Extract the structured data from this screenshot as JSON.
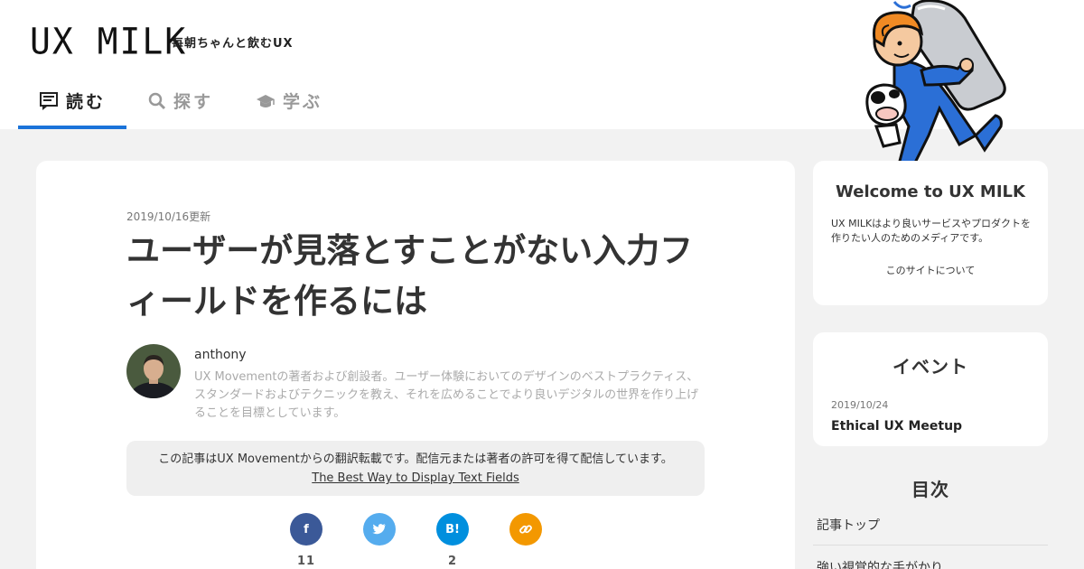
{
  "header": {
    "logo": "UX MILK",
    "tagline": "毎朝ちゃんと飲むUX",
    "nav": [
      {
        "label": "読む",
        "icon": "reader-icon",
        "active": true
      },
      {
        "label": "探す",
        "icon": "search-icon",
        "active": false
      },
      {
        "label": "学ぶ",
        "icon": "graduation-cap-icon",
        "active": false
      }
    ]
  },
  "article": {
    "date": "2019/10/16更新",
    "title": "ユーザーが見落とすことがない入力フィールドを作るには",
    "author": {
      "name": "anthony",
      "bio": "UX Movementの著者および創設者。ユーザー体験においてのデザインのベストプラクティス、スタンダードおよびテクニックを教え、それを広めることでより良いデジタルの世界を作り上げることを目標としています。"
    },
    "notice": {
      "text": "この記事はUX Movementからの翻訳転載です。配信元または著者の許可を得て配信しています。",
      "link": "The Best Way to Display Text Fields"
    },
    "share": [
      {
        "icon": "facebook-icon",
        "glyph": "f",
        "count": "11",
        "color": "#3b5998"
      },
      {
        "icon": "twitter-icon",
        "glyph": "",
        "count": "",
        "color": "#55acee"
      },
      {
        "icon": "hatena-bookmark-icon",
        "glyph": "B!",
        "count": "2",
        "color": "#008fde"
      },
      {
        "icon": "link-icon",
        "glyph": "",
        "count": "",
        "color": "#f39800"
      }
    ]
  },
  "sidebar": {
    "welcome": {
      "title": "Welcome to UX MILK",
      "description": "UX MILKはより良いサービスやプロダクトを作りたい人のためのメディアです。",
      "link": "このサイトについて"
    },
    "event": {
      "title": "イベント",
      "date": "2019/10/24",
      "name": "Ethical UX Meetup"
    },
    "toc": {
      "title": "目次",
      "items": [
        "記事トップ",
        "強い視覚的な手がかり"
      ]
    }
  },
  "colors": {
    "accent": "#1a73d9",
    "mascot_blue": "#2b6fd6",
    "mascot_orange": "#f08a24"
  }
}
